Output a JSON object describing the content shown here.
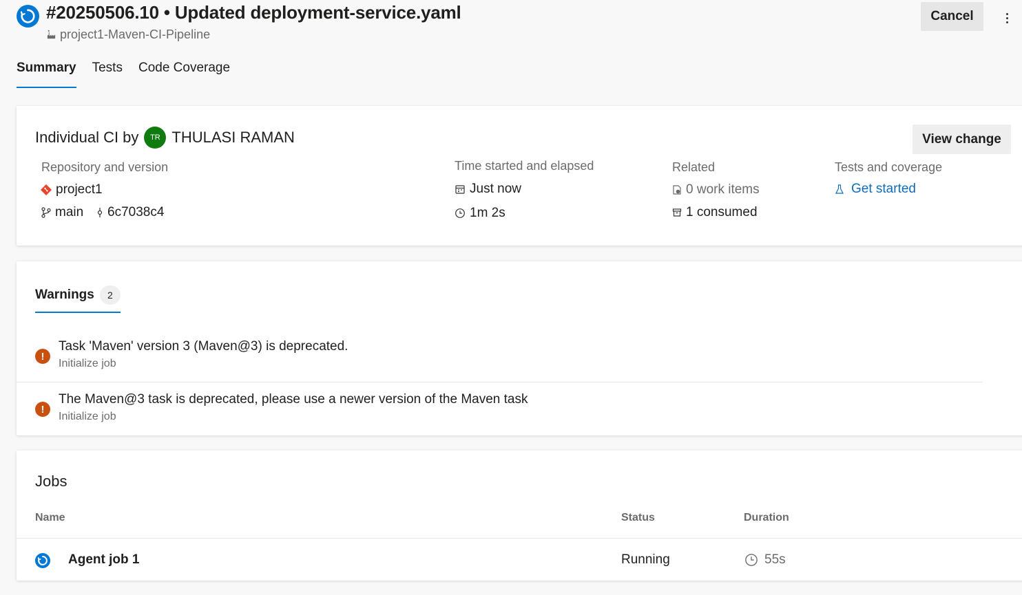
{
  "header": {
    "run_title": "#20250506.10 • Updated deployment-service.yaml",
    "pipeline_name": "project1-Maven-CI-Pipeline",
    "cancel_label": "Cancel"
  },
  "tabs": [
    {
      "label": "Summary",
      "active": true
    },
    {
      "label": "Tests",
      "active": false
    },
    {
      "label": "Code Coverage",
      "active": false
    }
  ],
  "summary": {
    "trigger_text": "Individual CI by",
    "avatar_initials": "TR",
    "author": "THULASI RAMAN",
    "view_change_label": "View change",
    "repo": {
      "label": "Repository and version",
      "name": "project1",
      "branch": "main",
      "commit": "6c7038c4"
    },
    "time": {
      "label": "Time started and elapsed",
      "started": "Just now",
      "elapsed": "1m 2s"
    },
    "related": {
      "label": "Related",
      "work_items": "0 work items",
      "consumed": "1 consumed"
    },
    "tests": {
      "label": "Tests and coverage",
      "link": "Get started"
    }
  },
  "warnings": {
    "tab_label": "Warnings",
    "count": "2",
    "items": [
      {
        "message": "Task 'Maven' version 3 (Maven@3) is deprecated.",
        "source": "Initialize job"
      },
      {
        "message": "The Maven@3 task is deprecated, please use a newer version of the Maven task",
        "source": "Initialize job"
      }
    ]
  },
  "jobs": {
    "title": "Jobs",
    "columns": {
      "name": "Name",
      "status": "Status",
      "duration": "Duration"
    },
    "rows": [
      {
        "name": "Agent job 1",
        "status": "Running",
        "duration": "55s"
      }
    ]
  },
  "colors": {
    "accent": "#0078d4",
    "link": "#0f6cbd",
    "warning": "#ca5010",
    "avatar": "#107c10",
    "git": "#e8442b"
  }
}
